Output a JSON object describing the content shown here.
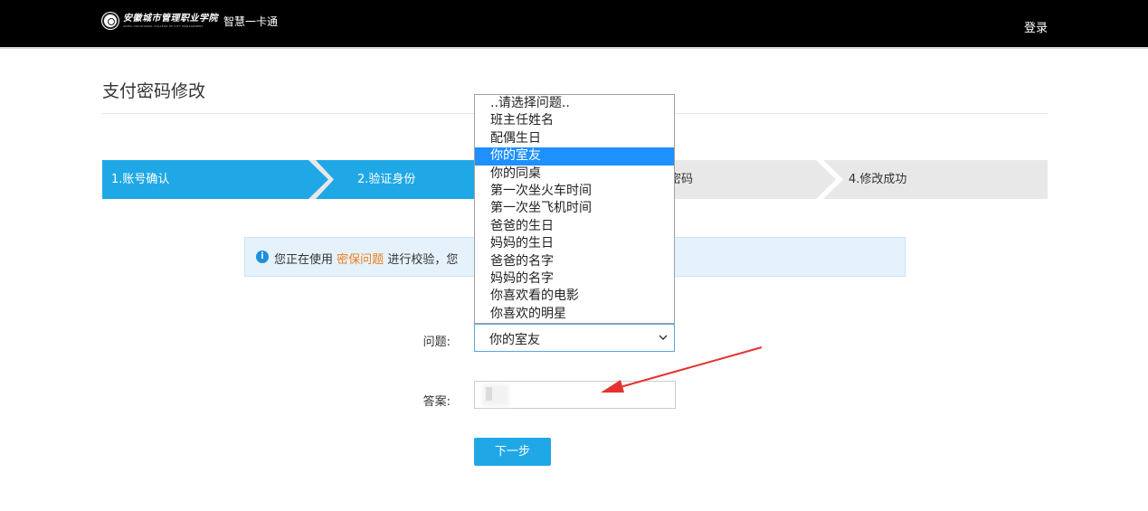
{
  "header": {
    "school_name_cn": "安徽城市管理职业学院",
    "school_name_en": "ANHUI VOCATIONAL COLLEGE OF CITY MANAGEMENT",
    "app_name": "智慧一卡通",
    "login_label": "登录"
  },
  "page": {
    "title": "支付密码修改"
  },
  "steps": [
    "1.账号确认",
    "2.验证身份",
    "3.修改密码",
    "4.修改成功"
  ],
  "visible_step3_fragment": "密码",
  "info": {
    "prefix": "您正在使用",
    "highlight": "密保问题",
    "suffix": "进行校验，您"
  },
  "form": {
    "question_label": "问题:",
    "question_value": "你的室友",
    "answer_label": "答案:",
    "answer_value": "",
    "next_label": "下一步"
  },
  "question_options": [
    "..请选择问题..",
    "班主任姓名",
    "配偶生日",
    "你的室友",
    "你的同桌",
    "第一次坐火车时间",
    "第一次坐飞机时间",
    "爸爸的生日",
    "妈妈的生日",
    "爸爸的名字",
    "妈妈的名字",
    "你喜欢看的电影",
    "你喜欢的明星"
  ],
  "selected_option_index": 3,
  "colors": {
    "topbar": "#000000",
    "accent": "#20a8e6",
    "highlight": "#f07b1f",
    "selected_option": "#1e90ff",
    "annotation_arrow": "#e5322d"
  }
}
